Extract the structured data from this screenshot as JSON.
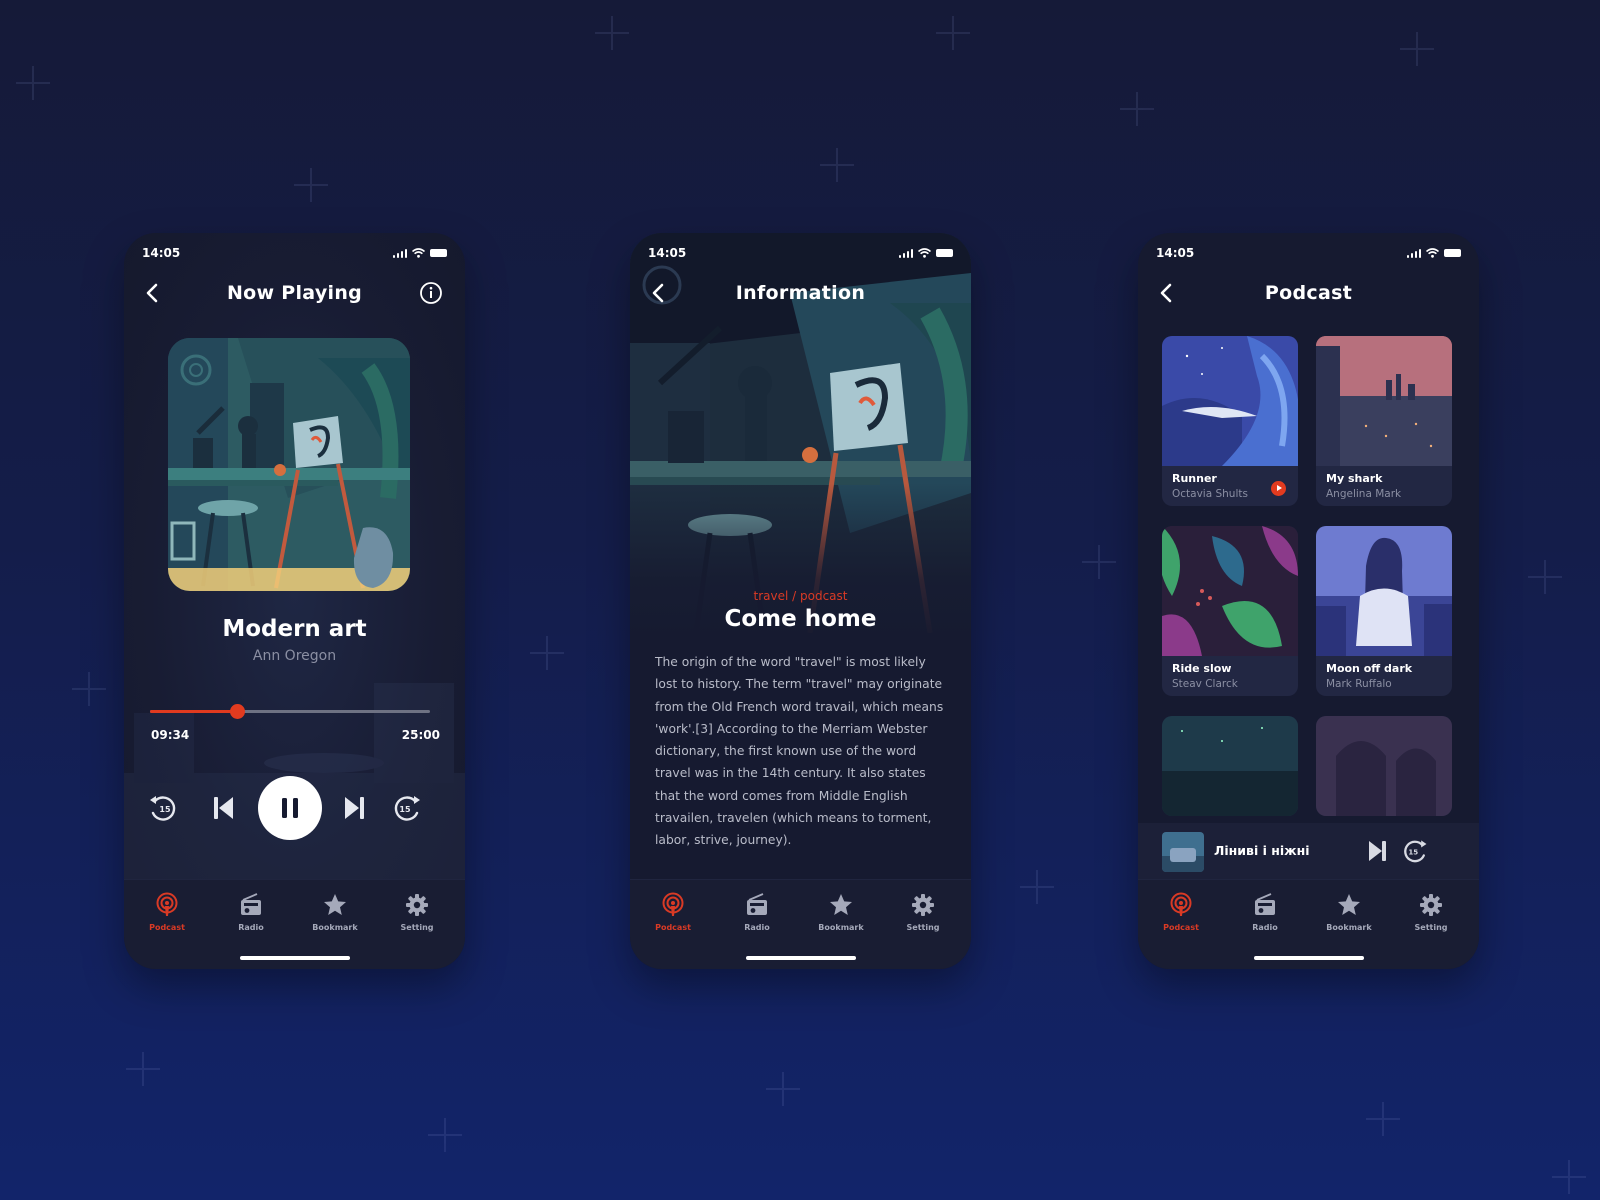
{
  "status": {
    "time": "14:05"
  },
  "tabs": {
    "podcast": "Podcast",
    "radio": "Radio",
    "bookmark": "Bookmark",
    "setting": "Setting"
  },
  "colors": {
    "accent": "#d93a25",
    "background": "#161a30",
    "card": "#222743"
  },
  "now_playing": {
    "title": "Now Playing",
    "track_title": "Modern art",
    "artist": "Ann Oregon",
    "current_time": "09:34",
    "total_time": "25:00",
    "progress": 0.31,
    "skip_seconds": "15"
  },
  "information": {
    "title": "Information",
    "category": "travel / podcast",
    "episode_title": "Come home",
    "description": "The origin of the word \"travel\" is most likely lost to history. The term \"travel\" may originate from the Old French word travail, which means 'work'.[3] According to the Merriam Webster dictionary, the first known use of the word travel was in the 14th century. It also states that the word comes from Middle English travailen, travelen (which means to torment, labor, strive, journey)."
  },
  "podcast": {
    "title": "Podcast",
    "items": [
      {
        "title": "Runner",
        "author": "Octavia Shults"
      },
      {
        "title": "My shark",
        "author": "Angelina Mark"
      },
      {
        "title": "Ride slow",
        "author": "Steav Clarck"
      },
      {
        "title": "Moon off dark",
        "author": "Mark Ruffalo"
      }
    ],
    "mini_player": {
      "title": "Ліниві і ніжні"
    }
  }
}
